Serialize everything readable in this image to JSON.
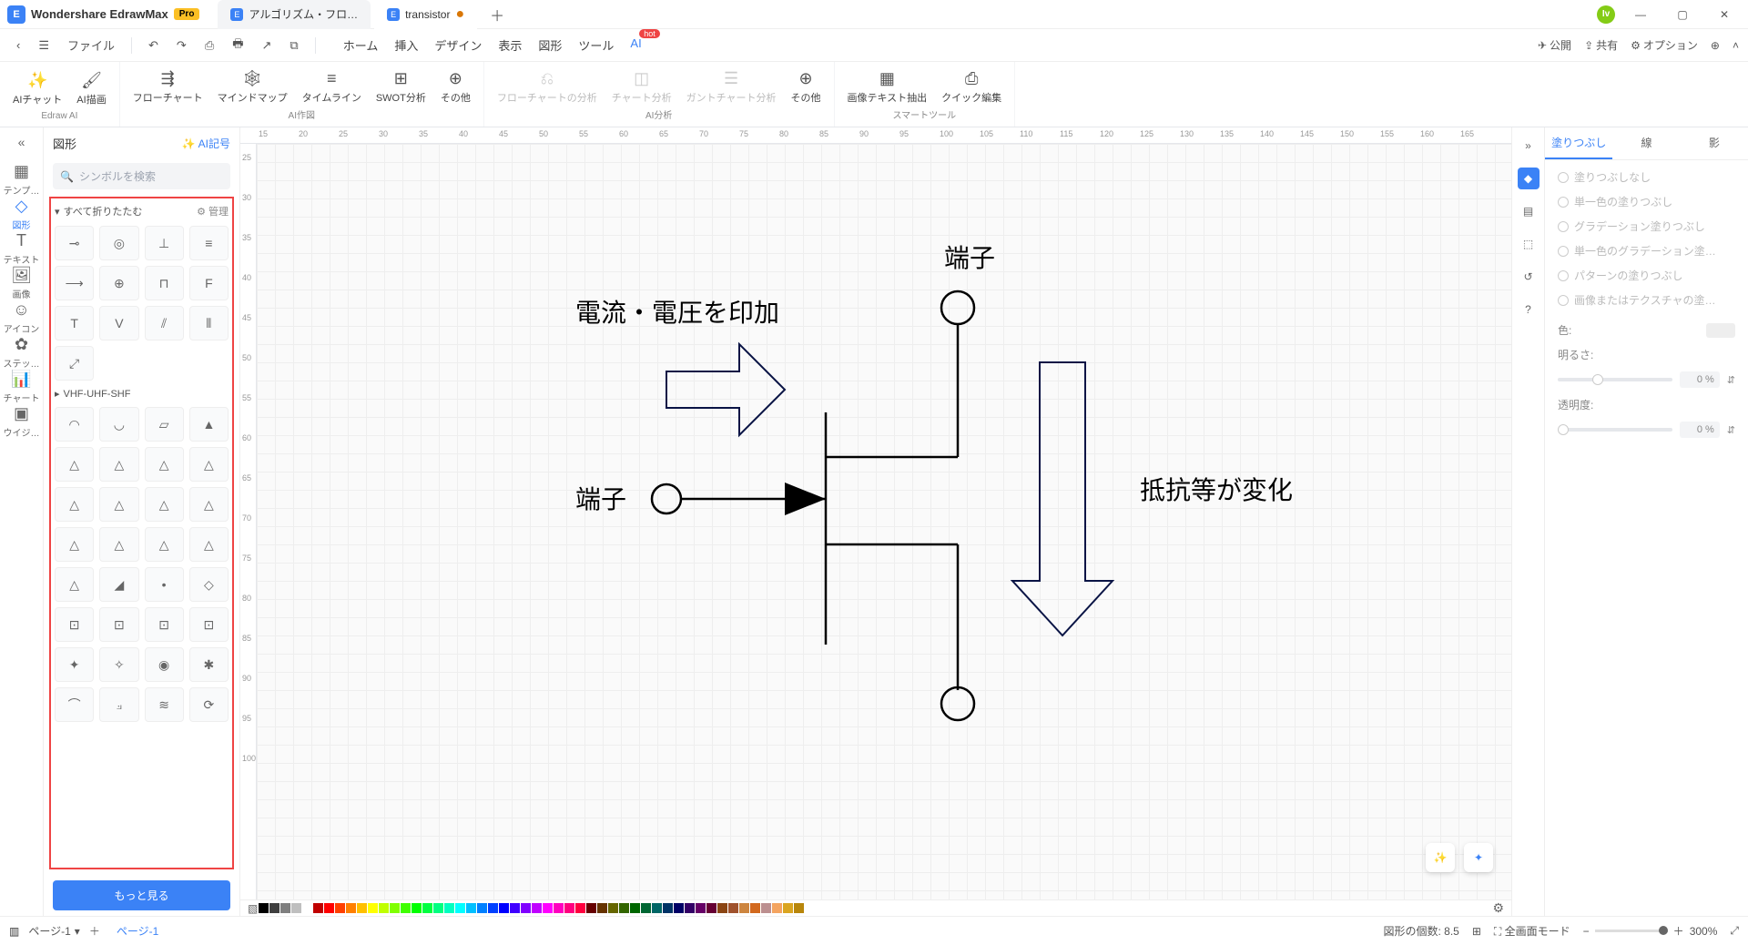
{
  "app": {
    "name": "Wondershare EdrawMax",
    "badge": "Pro",
    "user_initial": "Iv"
  },
  "tabs": [
    {
      "label": "アルゴリズム・フロ…"
    },
    {
      "label": "transistor",
      "modified": true
    }
  ],
  "file_menu": {
    "file": "ファイル"
  },
  "menus": [
    "ホーム",
    "挿入",
    "デザイン",
    "表示",
    "図形",
    "ツール",
    "AI"
  ],
  "menu_hot": "hot",
  "menu_right": {
    "publish": "公開",
    "share": "共有",
    "options": "オプション"
  },
  "ribbon": {
    "groups": [
      {
        "label": "Edraw AI",
        "items": [
          "AIチャット",
          "AI描画"
        ]
      },
      {
        "label": "AI作図",
        "items": [
          "フローチャート",
          "マインドマップ",
          "タイムライン",
          "SWOT分析",
          "その他"
        ]
      },
      {
        "label": "AI分析",
        "items": [
          "フローチャートの分析",
          "チャート分析",
          "ガントチャート分析",
          "その他"
        ],
        "disabled": [
          0,
          1,
          2
        ]
      },
      {
        "label": "スマートツール",
        "items": [
          "画像テキスト抽出",
          "クイック編集"
        ]
      }
    ]
  },
  "leftnav": [
    "テンプ…",
    "図形",
    "テキスト",
    "画像",
    "アイコン",
    "ステッ…",
    "チャート",
    "ウイジ…"
  ],
  "shapes": {
    "title": "図形",
    "ai_symbol": "AI記号",
    "search_placeholder": "シンボルを検索",
    "collapse_all": "すべて折りたたむ",
    "manage": "管理",
    "section2": "VHF-UHF-SHF",
    "more": "もっと見る"
  },
  "diagram": {
    "terminal_top": "端子",
    "terminal_left": "端子",
    "apply": "電流・電圧を印加",
    "change": "抵抗等が変化"
  },
  "right": {
    "tabs": [
      "塗りつぶし",
      "線",
      "影"
    ],
    "fill_options": [
      "塗りつぶしなし",
      "単一色の塗りつぶし",
      "グラデーション塗りつぶし",
      "単一色のグラデーション塗…",
      "パターンの塗りつぶし",
      "画像またはテクスチャの塗…"
    ],
    "color": "色:",
    "brightness": "明るさ:",
    "opacity": "透明度:",
    "pct_zero": "0 %"
  },
  "status": {
    "page": "ページ-1",
    "page_tab": "ページ-1",
    "shape_count_label": "図形の個数:",
    "shape_count": "8.5",
    "fullscreen": "全画面モード",
    "zoom": "300%"
  },
  "ruler_h": [
    15,
    20,
    25,
    30,
    35,
    40,
    45,
    50,
    55,
    60,
    65,
    70,
    75,
    80,
    85,
    90,
    95,
    100,
    105,
    110,
    115,
    120,
    125,
    130,
    135,
    140,
    145,
    150,
    155,
    160,
    165
  ],
  "ruler_v": [
    25,
    30,
    35,
    40,
    45,
    50,
    55,
    60,
    65,
    70,
    75,
    80,
    85,
    90,
    95,
    100
  ],
  "colors": [
    "#000",
    "#3f3f3f",
    "#7f7f7f",
    "#bfbfbf",
    "#fff",
    "#c00000",
    "#f00",
    "#ff4000",
    "#ff8000",
    "#ffc000",
    "#ffff00",
    "#c0ff00",
    "#80ff00",
    "#40ff00",
    "#00ff00",
    "#00ff40",
    "#00ff80",
    "#00ffc0",
    "#00ffff",
    "#00c0ff",
    "#0080ff",
    "#0040ff",
    "#0000ff",
    "#4000ff",
    "#8000ff",
    "#c000ff",
    "#ff00ff",
    "#ff00c0",
    "#ff0080",
    "#ff0040",
    "#660000",
    "#663300",
    "#666600",
    "#336600",
    "#006600",
    "#006633",
    "#006666",
    "#003366",
    "#000066",
    "#330066",
    "#660066",
    "#660033",
    "#8b4513",
    "#a0522d",
    "#cd853f",
    "#d2691e",
    "#bc8f8f",
    "#f4a460",
    "#daa520",
    "#b8860b"
  ]
}
